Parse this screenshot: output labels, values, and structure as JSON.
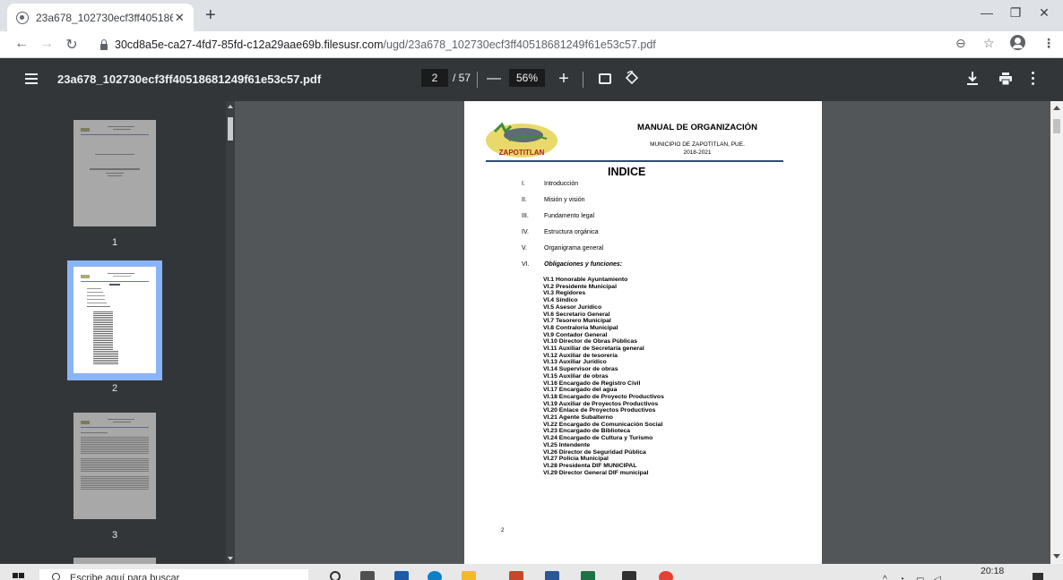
{
  "browser": {
    "tab_title": "23a678_102730ecf3ff40518681249f61e53c57.pdf",
    "tab_title_visible": "23a678_102730ecf3ff40518681249f61e53c57.pdf",
    "url_host": "30cd8a5e-ca27-4fd7-85fd-c12a29aae69b.filesusr.com",
    "url_path": "/ugd/23a678_102730ecf3ff40518681249f61e53c57.pdf",
    "icons": [
      "back-icon",
      "forward-icon",
      "reload-icon",
      "lock-icon",
      "zoom-icon",
      "star-icon",
      "profile-icon",
      "menu-icon"
    ]
  },
  "viewer": {
    "title": "23a678_102730ecf3ff40518681249f61e53c57.pdf",
    "current_page": "2",
    "total_pages": "/ 57",
    "zoom": "56%",
    "zoom_out_label": "—",
    "zoom_in_label": "+"
  },
  "thumbnails": [
    {
      "label": "1"
    },
    {
      "label": "2"
    },
    {
      "label": "3"
    }
  ],
  "document": {
    "title": "MANUAL DE ORGANIZACIÓN",
    "municipality": "MUNICIPIO DE ZAPOTITLAN, PUE.",
    "period": "2018-2021",
    "logo_text": "ZAPOTITLAN",
    "heading": "INDICE",
    "toc": [
      {
        "num": "I.",
        "text": "Introducción"
      },
      {
        "num": "II.",
        "text": "Misión y visión"
      },
      {
        "num": "III.",
        "text": "Fundamento legal"
      },
      {
        "num": "IV.",
        "text": "Estructura orgánica"
      },
      {
        "num": "V.",
        "text": "Organigrama general"
      },
      {
        "num": "VI.",
        "text": "Obligaciones y funciones:"
      }
    ],
    "sub_items": [
      "VI.1 Honorable Ayuntamiento",
      "VI.2 Presidente Municipal",
      "VI.3 Regidores",
      "VI.4 Síndico",
      "VI.5 Asesor Jurídico",
      "VI.6 Secretario General",
      "VI.7 Tesorero Municipal",
      "VI.8 Contraloría Municipal",
      "VI.9 Contador General",
      "VI.10 Director de Obras Públicas",
      "VI.11 Auxiliar de Secretaría general",
      "VI.12 Auxiliar de tesorería",
      "VI.13 Auxiliar Jurídico",
      "VI.14 Supervisor de obras",
      "VI.15 Auxiliar de obras",
      "VI.16 Encargado de Registro Civil",
      "VI.17 Encargado del agua",
      "VI.18 Encargado  de Proyecto Productivos",
      "VI.19 Auxiliar de Proyectos Productivos",
      "VI.20 Enlace de Proyectos Productivos",
      "VI.21 Agente Subalterno",
      "VI.22 Encargado de Comunicación Social",
      "VI.23  Encargado de Biblioteca",
      "VI.24 Encargado de Cultura y Turismo",
      "VI.25 Intendente",
      "VI.26 Director  de  Seguridad Pública",
      "VI.27 Policía Municipal",
      "VI.28 Presidenta DIF MUNICIPAL",
      "VI.29 Director General  DIF municipal"
    ],
    "page_number": "2"
  },
  "taskbar": {
    "search_placeholder": "Escribe aquí para buscar",
    "clock": "20:18"
  },
  "colors": {
    "viewer_toolbar": "#323639",
    "viewer_background": "#525659",
    "selection": "#8ab4f8",
    "rule": "#2e4a7a"
  }
}
